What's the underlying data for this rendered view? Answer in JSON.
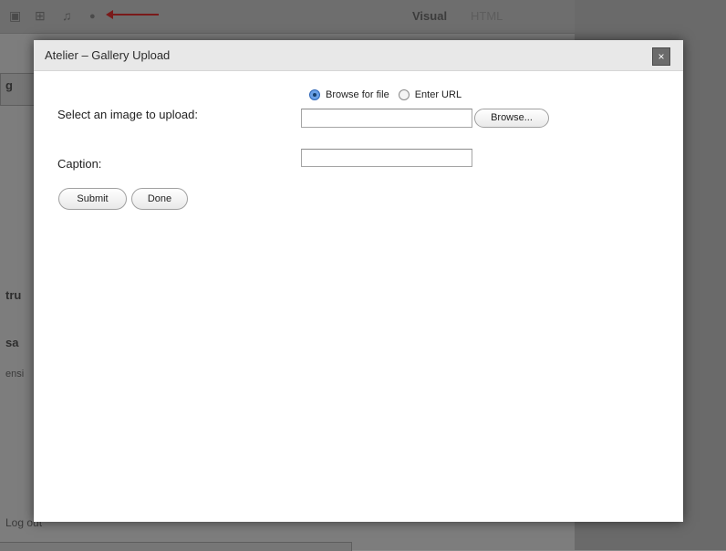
{
  "background": {
    "editor_tabs": {
      "visual": "Visual",
      "html": "HTML"
    },
    "toolbar_icons": [
      "image-icon",
      "gallery-icon",
      "music-icon",
      "media-icon"
    ],
    "fragments": [
      "g",
      "tru",
      "sa",
      "ensi",
      "Log out"
    ]
  },
  "dialog": {
    "title": "Atelier – Gallery Upload",
    "close_label": "×",
    "image_label": "Select an image to upload:",
    "source_options": [
      {
        "label": "Browse for file",
        "checked": true
      },
      {
        "label": "Enter URL",
        "checked": false
      }
    ],
    "file_value": "",
    "browse_label": "Browse...",
    "caption_label": "Caption:",
    "caption_value": "",
    "submit_label": "Submit",
    "done_label": "Done"
  },
  "colors": {
    "overlay": "#7d7d7d",
    "dialog_background": "#ffffff",
    "titlebar": "#e8e8e8",
    "accent_radio": "#6aa0e6",
    "annotation_arrow": "#7a1a1a"
  }
}
